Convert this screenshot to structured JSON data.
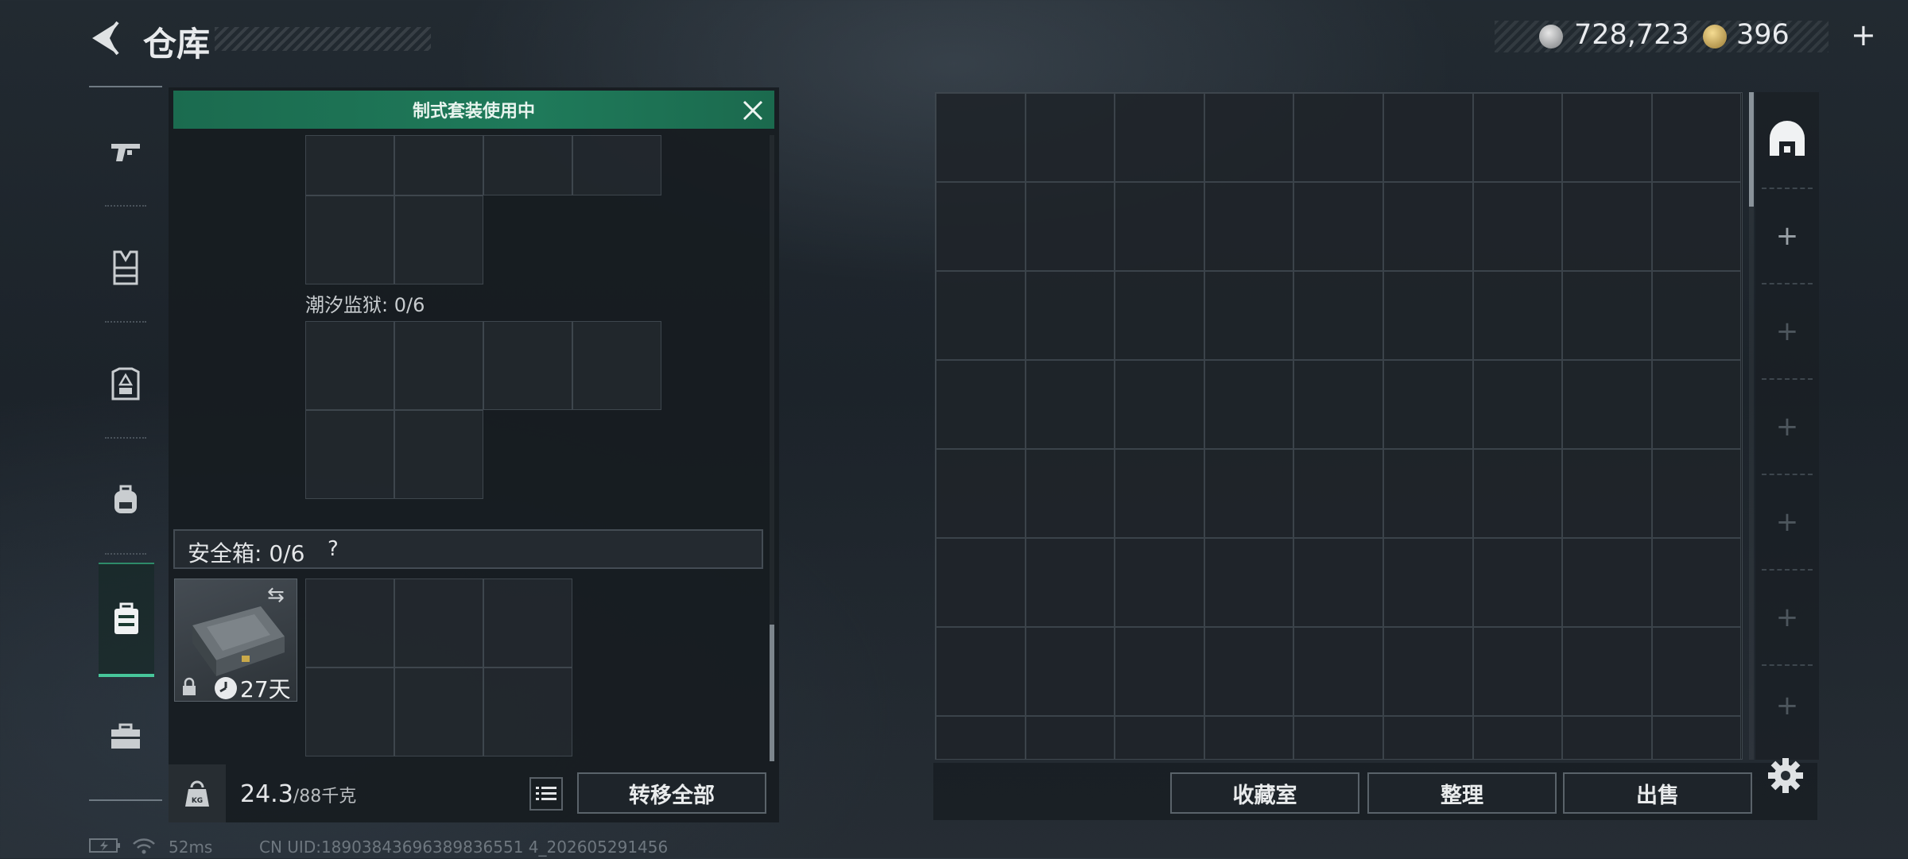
{
  "header": {
    "title": "仓库",
    "currency_silver": "728,723",
    "currency_gold": "396",
    "add_label": "+"
  },
  "nav": {
    "items": [
      "pistol-icon",
      "vest-icon",
      "armor-icon",
      "backpack-icon",
      "safe-case-icon",
      "toolbox-icon"
    ],
    "active_index": 4
  },
  "left_panel": {
    "banner": "制式套装使用中",
    "section_label": "潮汐监狱: 0/6",
    "safe_box_label": "安全箱: 0/6",
    "help_glyph": "?",
    "safe_item": {
      "days_left": "27天",
      "locked": true
    },
    "weight_current": "24.3",
    "weight_max": "/88千克",
    "transfer_all": "转移全部"
  },
  "right_panel": {
    "buttons": [
      "收藏室",
      "整理",
      "出售"
    ]
  },
  "status_bar": {
    "ping": "52ms",
    "uid": "CN UID:18903843696389836551 4_202605291456"
  }
}
